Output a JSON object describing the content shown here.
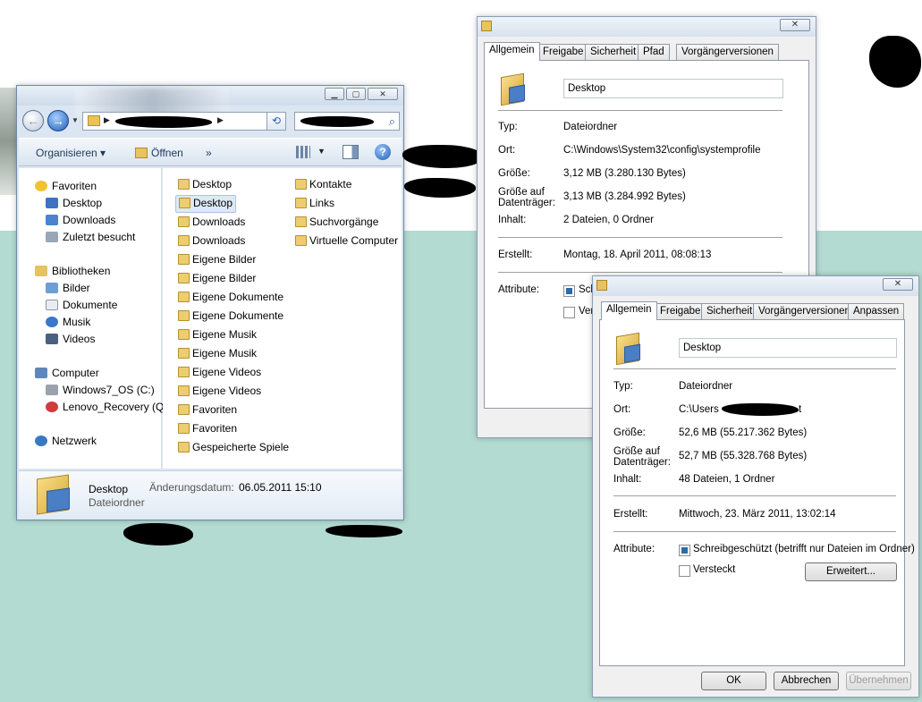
{
  "explorer": {
    "nav_items": [
      {
        "label": "Favoriten",
        "icon": "star-icon"
      },
      {
        "label": "Desktop",
        "icon": "desktop-icon"
      },
      {
        "label": "Downloads",
        "icon": "downloads-icon"
      },
      {
        "label": "Zuletzt besucht",
        "icon": "recent-icon"
      },
      {
        "label": "Bibliotheken",
        "icon": "libraries-icon"
      },
      {
        "label": "Bilder",
        "icon": "pictures-icon"
      },
      {
        "label": "Dokumente",
        "icon": "documents-icon"
      },
      {
        "label": "Musik",
        "icon": "music-icon"
      },
      {
        "label": "Videos",
        "icon": "videos-icon"
      },
      {
        "label": "Computer",
        "icon": "computer-icon"
      },
      {
        "label": "Windows7_OS (C:)",
        "icon": "drive-icon"
      },
      {
        "label": "Lenovo_Recovery (Q:",
        "icon": "recovery-drive-icon"
      },
      {
        "label": "Netzwerk",
        "icon": "network-icon"
      }
    ],
    "toolbar": {
      "organize": "Organisieren",
      "open": "Öffnen",
      "more": "»"
    },
    "files_col1": [
      "Desktop",
      "Desktop",
      "Downloads",
      "Downloads",
      "Eigene Bilder",
      "Eigene Bilder",
      "Eigene Dokumente",
      "Eigene Dokumente",
      "Eigene Musik",
      "Eigene Musik",
      "Eigene Videos",
      "Eigene Videos",
      "Favoriten",
      "Favoriten",
      "Gespeicherte Spiele"
    ],
    "files_col2": [
      "Kontakte",
      "Links",
      "Suchvorgänge",
      "Virtuelle Computer"
    ],
    "details": {
      "name": "Desktop",
      "type": "Dateiordner",
      "date_label": "Änderungsdatum:",
      "date_value": "06.05.2011 15:10"
    }
  },
  "dialog1": {
    "tabs": [
      "Allgemein",
      "Freigabe",
      "Sicherheit",
      "Pfad",
      "Vorgängerversionen"
    ],
    "name": "Desktop",
    "labels": {
      "type": "Typ:",
      "location": "Ort:",
      "size": "Größe:",
      "size_on_disk": "Größe auf Datenträger:",
      "contents": "Inhalt:",
      "created": "Erstellt:",
      "attributes": "Attribute:"
    },
    "values": {
      "type": "Dateiordner",
      "location": "C:\\Windows\\System32\\config\\systemprofile",
      "size": "3,12 MB (3.280.130 Bytes)",
      "size_on_disk": "3,13 MB (3.284.992 Bytes)",
      "contents": "2 Dateien, 0 Ordner",
      "created": "Montag, 18. April 2011, 08:08:13"
    },
    "attr_readonly_partial": "Sch",
    "attr_hidden_partial": "Ver"
  },
  "dialog2": {
    "tabs": [
      "Allgemein",
      "Freigabe",
      "Sicherheit",
      "Vorgängerversionen",
      "Anpassen"
    ],
    "name": "Desktop",
    "labels": {
      "type": "Typ:",
      "location": "Ort:",
      "size": "Größe:",
      "size_on_disk": "Größe auf Datenträger:",
      "contents": "Inhalt:",
      "created": "Erstellt:",
      "attributes": "Attribute:"
    },
    "values": {
      "type": "Dateiordner",
      "location_prefix": "C:\\Users",
      "location_suffix": "t",
      "size": "52,6 MB (55.217.362 Bytes)",
      "size_on_disk": "52,7 MB (55.328.768 Bytes)",
      "contents": "48 Dateien, 1 Ordner",
      "created": "Mittwoch, 23. März 2011, 13:02:14"
    },
    "attr_readonly": "Schreibgeschützt (betrifft nur Dateien im Ordner)",
    "attr_hidden": "Versteckt",
    "advanced_button": "Erweitert...",
    "buttons": {
      "ok": "OK",
      "cancel": "Abbrechen",
      "apply": "Übernehmen"
    }
  }
}
